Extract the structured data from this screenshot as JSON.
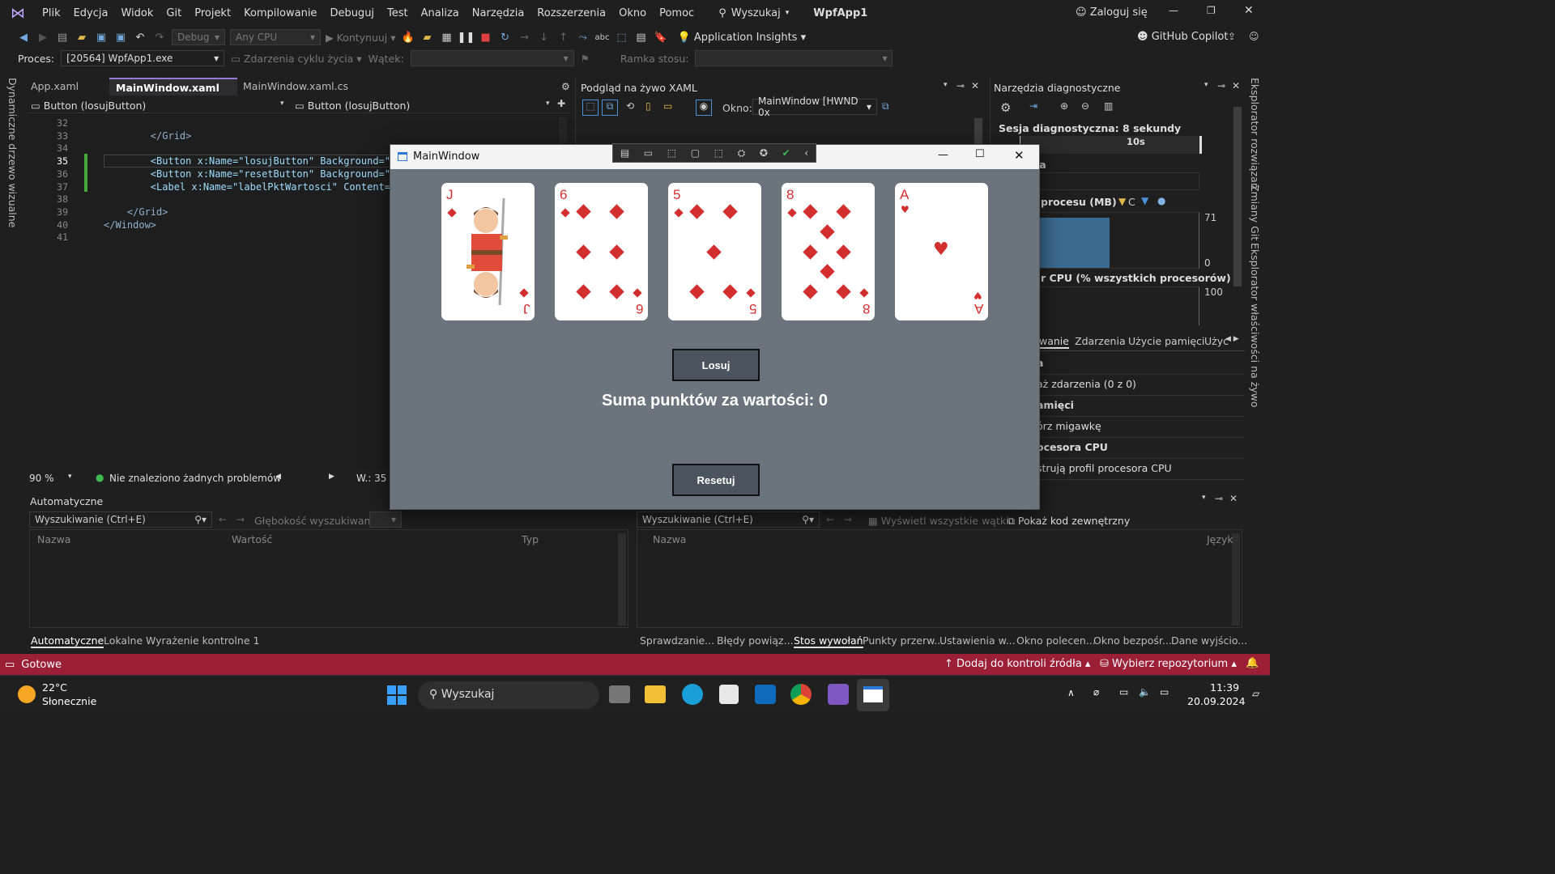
{
  "menu": [
    "Plik",
    "Edycja",
    "Widok",
    "Git",
    "Projekt",
    "Kompilowanie",
    "Debuguj",
    "Test",
    "Analiza",
    "Narzędzia",
    "Rozszerzenia",
    "Okno",
    "Pomoc"
  ],
  "search_label": "Wyszukaj",
  "app_title": "WpfApp1",
  "login": "Zaloguj się",
  "toolbar": {
    "config": "Debug",
    "platform": "Any CPU",
    "continue": "Kontynuuj",
    "app_insights": "Application Insights",
    "copilot": "GitHub Copilot"
  },
  "procbar": {
    "proc_label": "Proces:",
    "proc_value": "[20564] WpfApp1.exe",
    "lifecycle": "Zdarzenia cyklu życia",
    "thread": "Wątek:",
    "stack": "Ramka stosu:"
  },
  "editor": {
    "tabs": [
      "App.xaml",
      "MainWindow.xaml",
      "MainWindow.xaml.cs"
    ],
    "nav_left": "Button (losujButton)",
    "nav_right": "Button (losujButton)",
    "line_numbers": [
      "32",
      "33",
      "34",
      "35",
      "36",
      "37",
      "38",
      "39",
      "40",
      "41"
    ],
    "lines": [
      "",
      "        </Grid>",
      "",
      "        <Button x:Name=\"losujButton\" Background=\"",
      "        <Button x:Name=\"resetButton\" Background=\"",
      "        <Label x:Name=\"labelPktWartosci\" Content=\"S",
      "",
      "    </Grid>",
      "</Window>",
      ""
    ],
    "zoom": "90 %",
    "issues": "Nie znaleziono żadnych problemów",
    "col": "W.: 35"
  },
  "live_xaml": {
    "title": "Podgląd na żywo XAML",
    "window_label": "Okno:",
    "window_value": "MainWindow [HWND 0x"
  },
  "diag": {
    "title": "Narzędzia diagnostyczne",
    "session": "Sesja diagnostyczna: 8 sekundy",
    "tick": "10s",
    "events": "ia",
    "mem": "procesu (MB)",
    "mem_c": "C",
    "max": "71",
    "min": "0",
    "cpu": "r CPU (% wszystkich procesorów)",
    "cpu_max": "100",
    "tabs": [
      "wanie",
      "Zdarzenia",
      "Użycie pamięci",
      "Użyc"
    ],
    "rows": [
      "a",
      "aż zdarzenia (0 z 0)",
      "amięci",
      "órz migawkę",
      "ocesora CPU",
      "strują profil procesora CPU"
    ]
  },
  "right_vtabs": [
    "Eksplorator rozwiązań",
    "Zmiany Git",
    "Eksplorator właściwości na żywo"
  ],
  "left_vtab": "Dynamiczne drzewo wizualne",
  "autos": {
    "title": "Automatyczne",
    "search": "Wyszukiwanie (Ctrl+E)",
    "depth": "Głębokość wyszukiwania:",
    "cols": [
      "Nazwa",
      "Wartość",
      "Typ"
    ],
    "tabs": [
      "Automatyczne",
      "Lokalne",
      "Wyrażenie kontrolne 1"
    ]
  },
  "callstack": {
    "search": "Wyszukiwanie (Ctrl+E)",
    "show_threads": "Wyświetl wszystkie wątki",
    "external": "Pokaż kod zewnętrzny",
    "cols": [
      "Nazwa",
      "Język"
    ],
    "tabs": [
      "Sprawdzanie...",
      "Błędy powiąz...",
      "Stos wywołań",
      "Punkty przerw...",
      "Ustawienia w...",
      "Okno polecen...",
      "Okno bezpośr...",
      "Dane wyjścio..."
    ]
  },
  "status": {
    "ready": "Gotowe",
    "source": "Dodaj do kontroli źródła",
    "repo": "Wybierz repozytorium"
  },
  "taskbar": {
    "temp": "22°C",
    "weather": "Słonecznie",
    "search": "Wyszukaj",
    "time": "11:39",
    "date": "20.09.2024"
  },
  "app": {
    "title": "MainWindow",
    "cards": [
      {
        "rank": "J",
        "suit": "diamond"
      },
      {
        "rank": "6",
        "suit": "diamond"
      },
      {
        "rank": "5",
        "suit": "diamond"
      },
      {
        "rank": "8",
        "suit": "diamond"
      },
      {
        "rank": "A",
        "suit": "heart"
      }
    ],
    "draw_button": "Losuj",
    "sum_label": "Suma punktów za wartości: 0",
    "reset_button": "Resetuj"
  },
  "colors": {
    "accent": "#9b1f36",
    "card_red": "#d32f2f",
    "window_bg": "#6b737d"
  }
}
